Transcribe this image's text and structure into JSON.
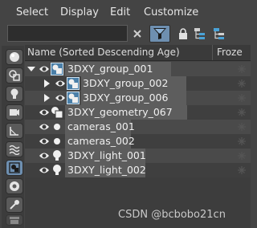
{
  "menu": {
    "items": [
      {
        "label": "Select"
      },
      {
        "label": "Display"
      },
      {
        "label": "Edit"
      },
      {
        "label": "Customize"
      }
    ]
  },
  "toolbar": {
    "search_value": "",
    "icons": [
      "close-icon",
      "filter-icon",
      "lock-icon",
      "hierarchy-icon",
      "hierarchy-alt-icon"
    ]
  },
  "filters": [
    {
      "icon": "sphere-icon",
      "active": false
    },
    {
      "icon": "shapes-icon",
      "active": false
    },
    {
      "icon": "light-bulb-icon",
      "active": false
    },
    {
      "icon": "camera-icon",
      "active": false
    },
    {
      "icon": "helper-icon",
      "active": false
    },
    {
      "icon": "spacewarp-icon",
      "active": false
    },
    {
      "icon": "group-icon",
      "active": true
    },
    {
      "icon": "xref-icon",
      "active": false
    },
    {
      "icon": "bone-icon",
      "active": false
    },
    {
      "icon": "container-icon",
      "active": false
    }
  ],
  "columns": {
    "name": "Name (Sorted Descending Age)",
    "frozen": "Froze"
  },
  "tree": [
    {
      "label": "3DXY_group_001",
      "level": 0,
      "expander": "expanded",
      "icon": "group-icon"
    },
    {
      "label": "3DXY_group_002",
      "level": 1,
      "expander": "collapsed",
      "icon": "group-icon"
    },
    {
      "label": "3DXY_group_006",
      "level": 1,
      "expander": "collapsed",
      "icon": "group-icon"
    },
    {
      "label": "3DXY_geometry_067",
      "level": 0,
      "expander": "none",
      "icon": "geometry-icon"
    },
    {
      "label": "cameras_001",
      "level": 0,
      "expander": "none",
      "icon": "dot-icon"
    },
    {
      "label": "cameras_002",
      "level": 0,
      "expander": "none",
      "icon": "dot-icon"
    },
    {
      "label": "3DXY_light_001",
      "level": 0,
      "expander": "none",
      "icon": "light-bulb-icon"
    },
    {
      "label": "3DXY_light_002",
      "level": 0,
      "expander": "none",
      "icon": "light-bulb-icon"
    }
  ],
  "watermark": "CSDN @bcbobo21cn"
}
